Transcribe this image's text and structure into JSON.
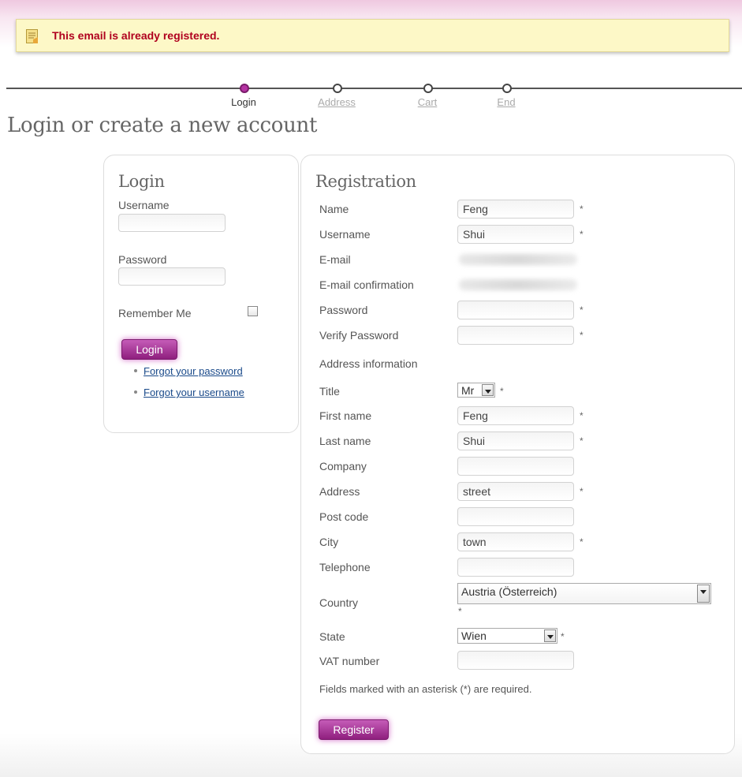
{
  "alert": {
    "message": "This email is already registered.",
    "icon": "note-icon"
  },
  "steps": [
    {
      "label": "Login",
      "active": true
    },
    {
      "label": "Address",
      "active": false
    },
    {
      "label": "Cart",
      "active": false
    },
    {
      "label": "End",
      "active": false
    }
  ],
  "page_title": "Login or create a new account",
  "login": {
    "title": "Login",
    "username_label": "Username",
    "username_value": "",
    "password_label": "Password",
    "password_value": "",
    "remember_label": "Remember Me",
    "remember_checked": false,
    "login_button": "Login",
    "forgot_password": "Forgot your password",
    "forgot_username": "Forgot your username"
  },
  "registration": {
    "title": "Registration",
    "name_label": "Name",
    "name_value": "Feng",
    "username_label": "Username",
    "username_value": "Shui",
    "email_label": "E-mail",
    "email_confirm_label": "E-mail confirmation",
    "password_label": "Password",
    "password_value": "",
    "verify_password_label": "Verify Password",
    "verify_password_value": "",
    "address_info_label": "Address information",
    "title_label": "Title",
    "title_value": "Mr",
    "first_name_label": "First name",
    "first_name_value": "Feng",
    "last_name_label": "Last name",
    "last_name_value": "Shui",
    "company_label": "Company",
    "company_value": "",
    "address_label": "Address",
    "address_value": "street",
    "post_code_label": "Post code",
    "post_code_value": "",
    "city_label": "City",
    "city_value": "town",
    "telephone_label": "Telephone",
    "telephone_value": "",
    "country_label": "Country",
    "country_value": "Austria (Österreich)",
    "state_label": "State",
    "state_value": "Wien",
    "vat_label": "VAT number",
    "vat_value": "",
    "required_note": "Fields marked with an asterisk (*) are required.",
    "register_button": "Register",
    "asterisk": "*"
  },
  "colors": {
    "accent": "#a3308f",
    "alert_text": "#b0001e",
    "alert_bg": "#fdf8c7"
  }
}
